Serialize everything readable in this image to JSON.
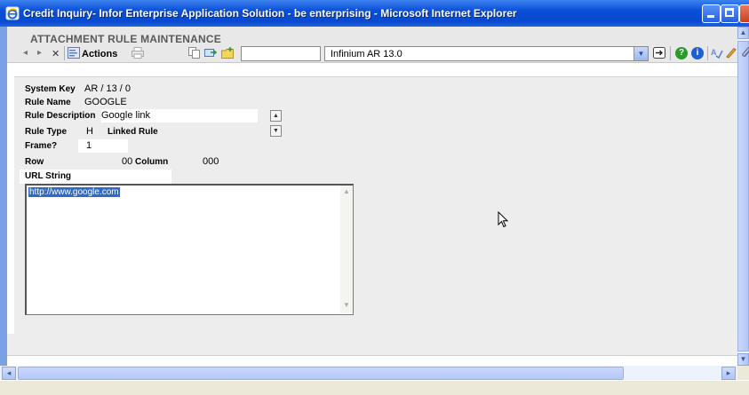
{
  "window": {
    "title": "Credit Inquiry- Infor Enterprise Application Solution - be enterprising - Microsoft Internet Explorer"
  },
  "app": {
    "title": "ATTACHMENT RULE MAINTENANCE"
  },
  "toolbar": {
    "back_icon": "◂",
    "forward_icon": "▸",
    "close_icon": "✕",
    "actions_label": "Actions",
    "select_value": "Infinium AR 13.0",
    "dropdown_arrow": "⌄"
  },
  "form": {
    "system_key_label": "System Key",
    "system_key_value": "AR   / 13 / 0",
    "rule_name_label": "Rule Name",
    "rule_name_value": "GOOGLE",
    "rule_description_label": "Rule Description",
    "rule_description_value": "Google link",
    "rule_type_label": "Rule Type",
    "rule_type_value": "H",
    "linked_rule_label": "Linked Rule",
    "frame_label": "Frame?",
    "frame_value": "1",
    "row_label": "Row",
    "row_value": "00",
    "column_label": "Column",
    "column_value": "000",
    "url_string_label": "URL String",
    "url_string_value": "http://www.google.com"
  },
  "colors": {
    "titlebar": "#0a4fd6",
    "selection": "#316ac5",
    "panel": "#ededed"
  }
}
